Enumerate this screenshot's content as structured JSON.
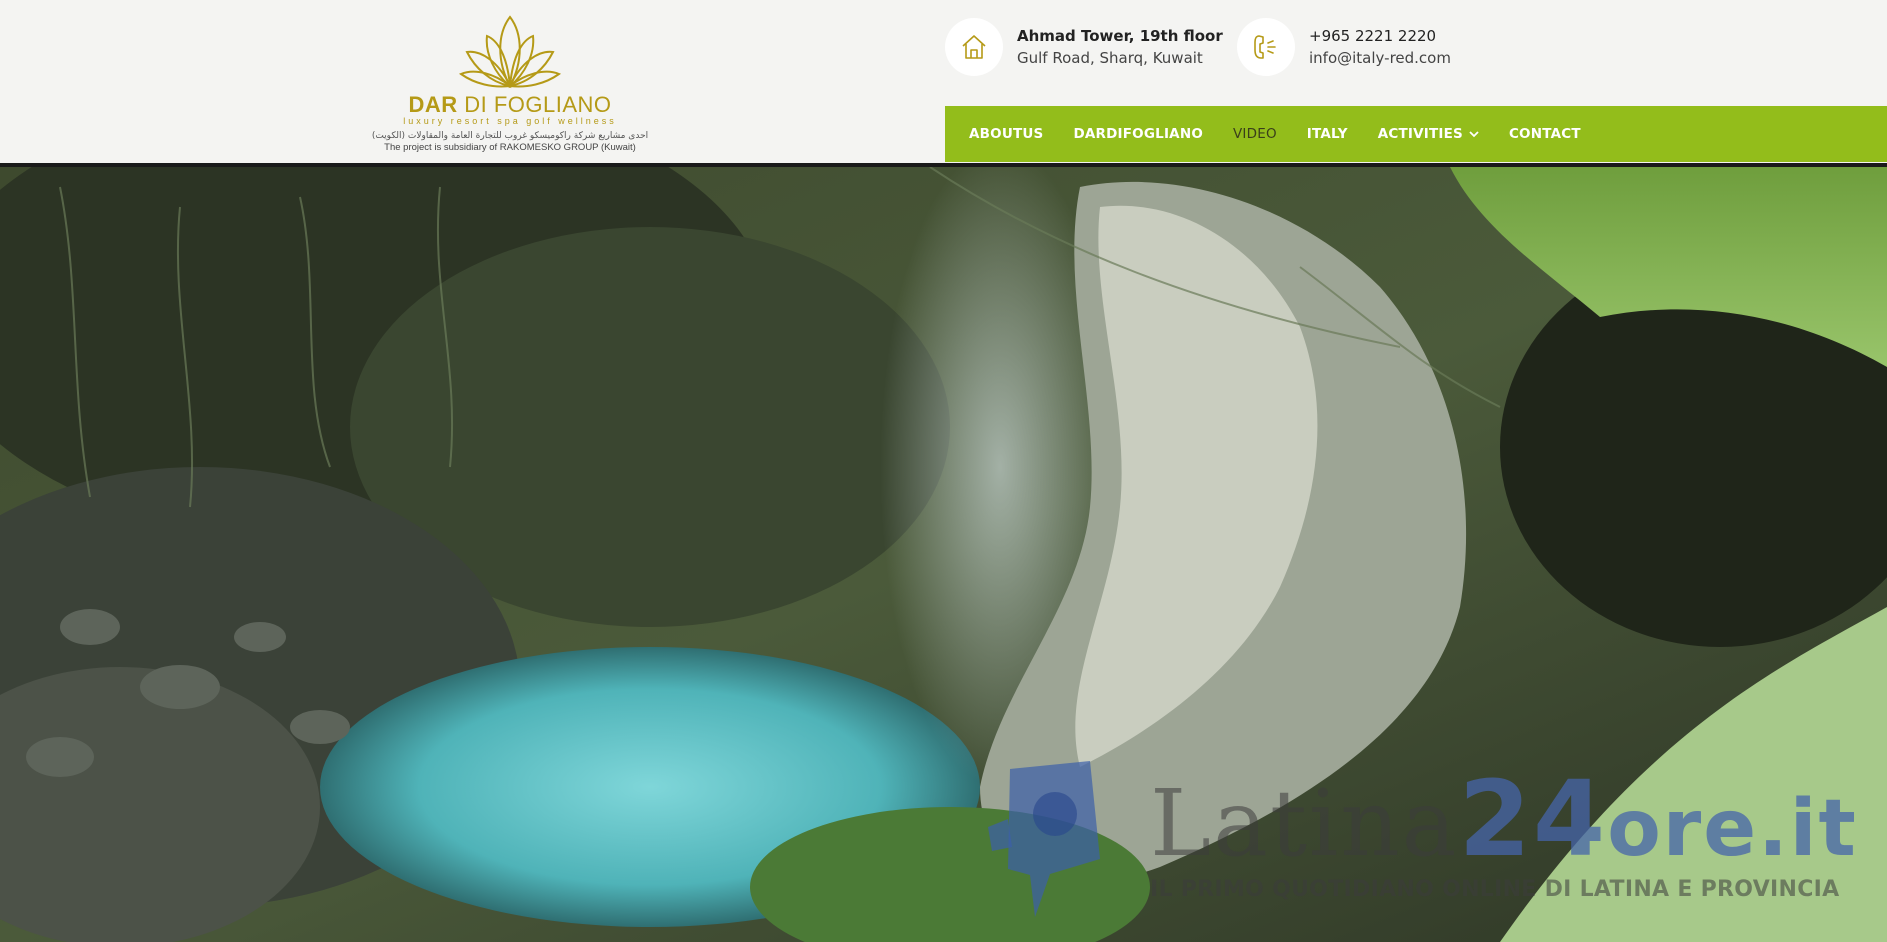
{
  "logo": {
    "name_part1": "DAR",
    "name_part2": " DI FOGLIANO",
    "tagline": "luxury  resort  spa  golf  wellness",
    "arabic": "احدى مشاريع شركة راكوميسكو غروب للتجارة العامة والمقاولات (الكويت)",
    "subsidiary": "The project is subsidiary of RAKOMESKO GROUP (Kuwait)",
    "icon": "lotus-logo-icon",
    "color": "#b59a17"
  },
  "contact": {
    "address_line1": "Ahmad Tower, 19th floor",
    "address_line2": "Gulf Road, Sharq, Kuwait",
    "address_icon": "house-icon",
    "phone": "+965 2221 2220",
    "email": "info@italy-red.com",
    "phone_icon": "phone-icon"
  },
  "nav": {
    "color": "#93bd1b",
    "items": [
      {
        "label": "ABOUTUS"
      },
      {
        "label": "DARDIFOGLIANO"
      },
      {
        "label": "VIDEO"
      },
      {
        "label": "ITALY"
      },
      {
        "label": "ACTIVITIES",
        "icon": "chevron-down-icon"
      },
      {
        "label": "CONTACT"
      }
    ]
  },
  "hero": {
    "image": "waterfall-stream-forest-video-frame"
  },
  "watermark": {
    "brand_part1": "Latina",
    "brand_num": "24",
    "brand_part2": "ore.it",
    "slogan": "IL PRIMO QUOTIDIANO ONLINE DI LATINA E PROVINCIA",
    "icon": "latina24ore-logo-icon"
  }
}
